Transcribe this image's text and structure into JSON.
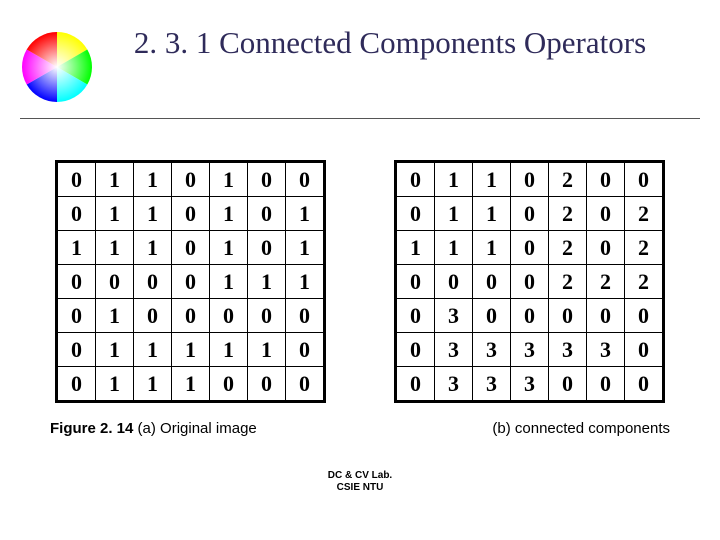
{
  "title": "2. 3. 1 Connected Components Operators",
  "table_a": [
    [
      "0",
      "1",
      "1",
      "0",
      "1",
      "0",
      "0"
    ],
    [
      "0",
      "1",
      "1",
      "0",
      "1",
      "0",
      "1"
    ],
    [
      "1",
      "1",
      "1",
      "0",
      "1",
      "0",
      "1"
    ],
    [
      "0",
      "0",
      "0",
      "0",
      "1",
      "1",
      "1"
    ],
    [
      "0",
      "1",
      "0",
      "0",
      "0",
      "0",
      "0"
    ],
    [
      "0",
      "1",
      "1",
      "1",
      "1",
      "1",
      "0"
    ],
    [
      "0",
      "1",
      "1",
      "1",
      "0",
      "0",
      "0"
    ]
  ],
  "table_b": [
    [
      "0",
      "1",
      "1",
      "0",
      "2",
      "0",
      "0"
    ],
    [
      "0",
      "1",
      "1",
      "0",
      "2",
      "0",
      "2"
    ],
    [
      "1",
      "1",
      "1",
      "0",
      "2",
      "0",
      "2"
    ],
    [
      "0",
      "0",
      "0",
      "0",
      "2",
      "2",
      "2"
    ],
    [
      "0",
      "3",
      "0",
      "0",
      "0",
      "0",
      "0"
    ],
    [
      "0",
      "3",
      "3",
      "3",
      "3",
      "3",
      "0"
    ],
    [
      "0",
      "3",
      "3",
      "3",
      "0",
      "0",
      "0"
    ]
  ],
  "caption_fig_label": "Figure 2. 14",
  "caption_a": " (a) Original image",
  "caption_b": "(b) connected components",
  "footer_line1": "DC & CV Lab.",
  "footer_line2": "CSIE NTU"
}
